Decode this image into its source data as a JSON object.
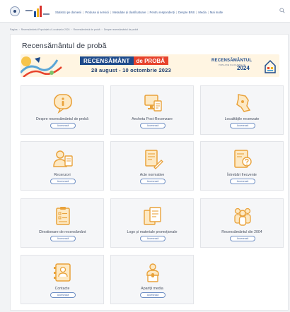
{
  "header": {
    "logo_icon": "institute-logo-icon",
    "nav": [
      {
        "label": "Statistici pe domenii"
      },
      {
        "label": "Produse și servicii"
      },
      {
        "label": "Metadate și clasificatoare"
      },
      {
        "label": "Pentru respondenți"
      },
      {
        "label": "Despre BNS"
      },
      {
        "label": "Media"
      },
      {
        "label": "Mai multe"
      }
    ],
    "search_icon": "search-icon"
  },
  "breadcrumb": [
    {
      "label": "Pagina"
    },
    {
      "label": "Recensământul Populației și Locuințelor 2024"
    },
    {
      "label": "Recensământul de probă"
    },
    {
      "label": "Despre recensământul de probă"
    }
  ],
  "page": {
    "title": "Recensământul de probă"
  },
  "banner": {
    "chip_left": "RECENSĂMÂNT",
    "chip_right": "de PROBĂ",
    "dates": "28 august - 10 octombrie 2023",
    "brand_name": "RECENSĂMÂNTUL",
    "brand_sub": "POPULAȚIEI ȘI LOCUINȚELOR",
    "brand_year": "2024",
    "colors": {
      "blue": "#1e4a8a",
      "red": "#e7432c",
      "background": "#fff5e2"
    }
  },
  "cards": [
    {
      "label": "Despre recensământul de probă",
      "button": "Accesează",
      "icon": "info-bubble-icon"
    },
    {
      "label": "Ancheta Post-Recenzare",
      "button": "Accesează",
      "icon": "survey-monitor-icon"
    },
    {
      "label": "Localitățile recenzate",
      "button": "Accesează",
      "icon": "map-region-icon"
    },
    {
      "label": "Recenzori",
      "button": "Accesează",
      "icon": "enumerator-badge-icon"
    },
    {
      "label": "Acte normative",
      "button": "Accesează",
      "icon": "document-pen-icon"
    },
    {
      "label": "Întrebări frecvente",
      "button": "Accesează",
      "icon": "faq-icon"
    },
    {
      "label": "Chestionare de recensământ",
      "button": "Accesează",
      "icon": "questionnaire-icon"
    },
    {
      "label": "Logo și materiale promoționale",
      "button": "Accesează",
      "icon": "promo-materials-icon"
    },
    {
      "label": "Recensământul din 2004",
      "button": "Accesează",
      "icon": "people-group-icon"
    },
    {
      "label": "Contacte",
      "button": "Accesează",
      "icon": "contacts-icon"
    },
    {
      "label": "Apariții media",
      "button": "Accesează",
      "icon": "media-speaker-icon"
    }
  ],
  "theme": {
    "accent": "#e9a23b",
    "link": "#3b5d95",
    "button_border": "#6f8fc4"
  }
}
